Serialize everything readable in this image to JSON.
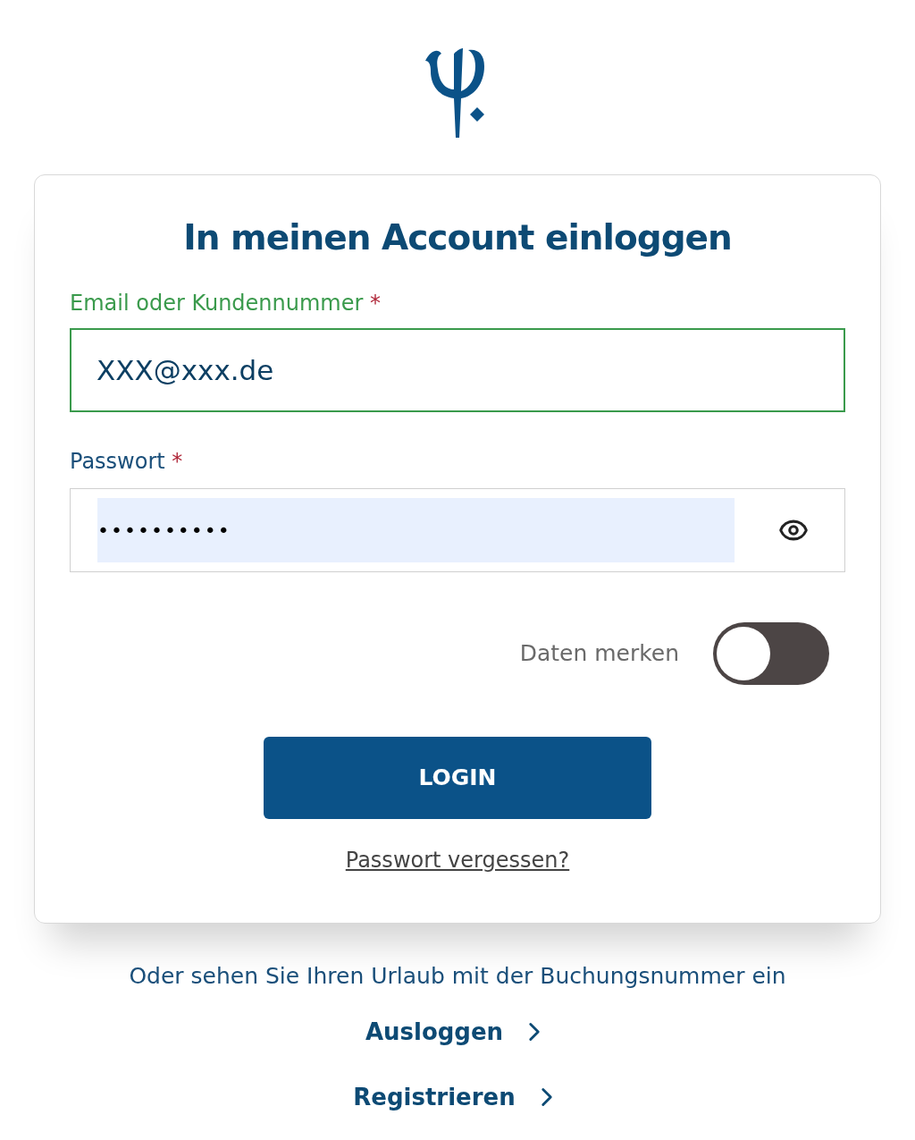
{
  "title": "In meinen Account einloggen",
  "email": {
    "label": "Email oder Kundennummer",
    "required_mark": "*",
    "value": "XXX@xxx.de",
    "focused": true
  },
  "password": {
    "label": "Passwort",
    "required_mark": "*",
    "value": "••••••••••"
  },
  "remember": {
    "label": "Daten merken",
    "on": false
  },
  "login_button": "LOGIN",
  "forgot_link": "Passwort vergessen?",
  "booking_text": "Oder sehen Sie Ihren Urlaub mit der Buchungsnummer ein",
  "links": [
    {
      "label": "Ausloggen"
    },
    {
      "label": "Registrieren"
    }
  ]
}
